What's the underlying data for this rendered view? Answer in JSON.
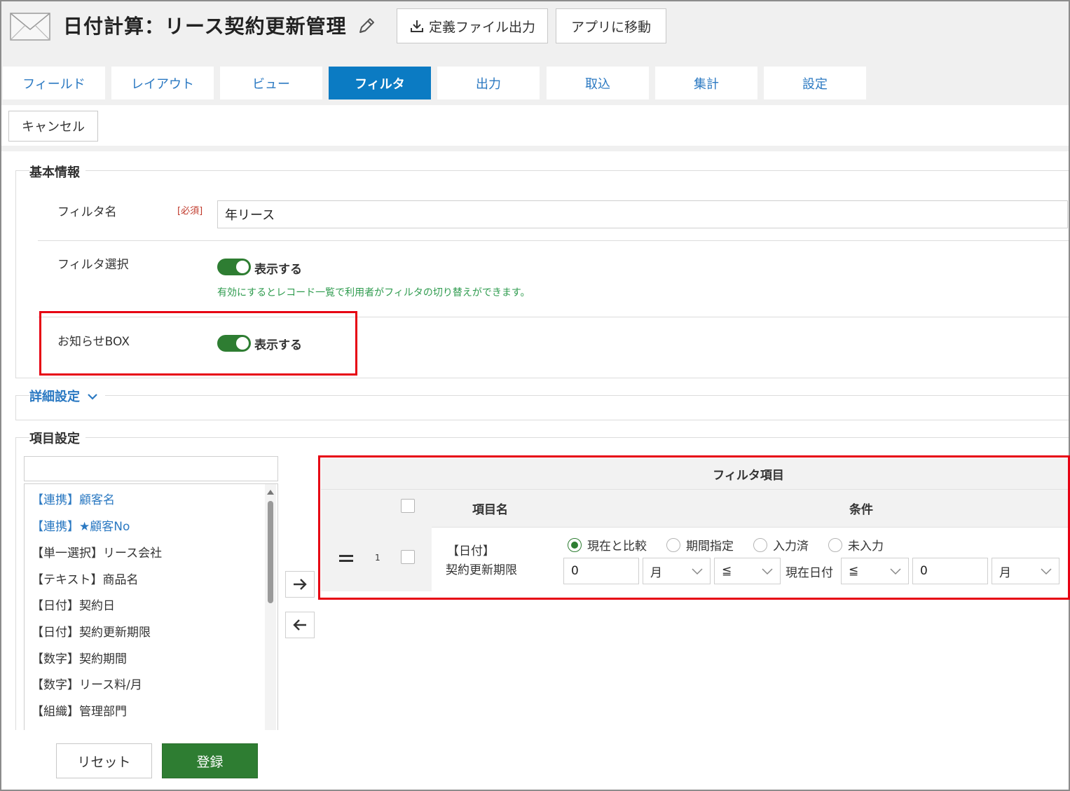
{
  "header": {
    "title": "日付計算：リース契約更新管理",
    "export_button": "定義ファイル出力",
    "go_to_app_button": "アプリに移動"
  },
  "tabs": [
    {
      "label": "フィールド",
      "active": false
    },
    {
      "label": "レイアウト",
      "active": false
    },
    {
      "label": "ビュー",
      "active": false
    },
    {
      "label": "フィルタ",
      "active": true
    },
    {
      "label": "出力",
      "active": false
    },
    {
      "label": "取込",
      "active": false
    },
    {
      "label": "集計",
      "active": false
    },
    {
      "label": "設定",
      "active": false
    }
  ],
  "toolbar": {
    "cancel_label": "キャンセル"
  },
  "basic_info": {
    "section_title": "基本情報",
    "filter_name_label": "フィルタ名",
    "required_badge": "[必須]",
    "filter_name_value": "年リース",
    "filter_select_label": "フィルタ選択",
    "filter_select_toggle_label": "表示する",
    "filter_select_help": "有効にするとレコード一覧で利用者がフィルタの切り替えができます。",
    "notice_box_label": "お知らせBOX",
    "notice_box_toggle_label": "表示する"
  },
  "details": {
    "label": "詳細設定"
  },
  "item_settings": {
    "section_title": "項目設定",
    "search_value": "",
    "field_list": [
      {
        "label": "【連携】顧客名",
        "linked": true
      },
      {
        "label": "【連携】★顧客No",
        "linked": true
      },
      {
        "label": "【単一選択】リース会社",
        "linked": false
      },
      {
        "label": "【テキスト】商品名",
        "linked": false
      },
      {
        "label": "【日付】契約日",
        "linked": false
      },
      {
        "label": "【日付】契約更新期限",
        "linked": false
      },
      {
        "label": "【数字】契約期間",
        "linked": false
      },
      {
        "label": "【数字】リース料/月",
        "linked": false
      },
      {
        "label": "【組織】管理部門",
        "linked": false
      }
    ]
  },
  "filter_items": {
    "title": "フィルタ項目",
    "col_item_name": "項目名",
    "col_condition": "条件",
    "rows": [
      {
        "index": "1",
        "type_label": "【日付】",
        "field_label": "契約更新期限",
        "radio_options": [
          "現在と比較",
          "期間指定",
          "入力済",
          "未入力"
        ],
        "radio_selected": "現在と比較",
        "value1": "0",
        "unit1": "月",
        "op1": "≦",
        "mid_text": "現在日付",
        "op2": "≦",
        "value2": "0",
        "unit2": "月"
      }
    ]
  },
  "footer": {
    "reset_label": "リセット",
    "register_label": "登録"
  },
  "colors": {
    "accent": "#0b7bc3",
    "toggle_on": "#2e7d32",
    "highlight": "#e60012",
    "link": "#2b79c2"
  }
}
